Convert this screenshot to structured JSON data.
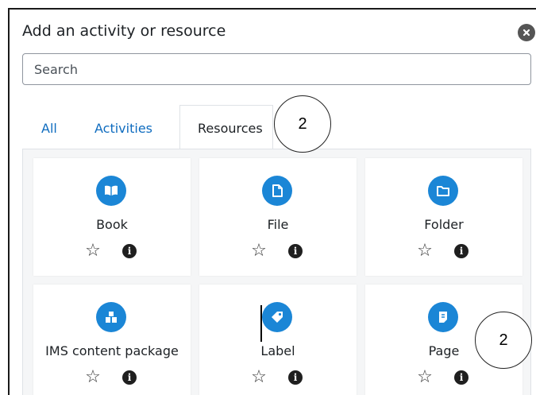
{
  "dialog": {
    "title": "Add an activity or resource",
    "search_placeholder": "Search"
  },
  "tabs": [
    {
      "label": "All",
      "active": false
    },
    {
      "label": "Activities",
      "active": false
    },
    {
      "label": "Resources",
      "active": true
    }
  ],
  "items": [
    {
      "label": "Book",
      "icon": "book-icon"
    },
    {
      "label": "File",
      "icon": "file-icon"
    },
    {
      "label": "Folder",
      "icon": "folder-icon"
    },
    {
      "label": "IMS content package",
      "icon": "package-icon"
    },
    {
      "label": "Label",
      "icon": "tag-icon"
    },
    {
      "label": "Page",
      "icon": "page-icon"
    }
  ],
  "callouts": [
    "2",
    "2"
  ],
  "colors": {
    "accent": "#0f6cbf",
    "icon_bg": "#1b86d6",
    "panel_bg": "#f5f6f7"
  }
}
